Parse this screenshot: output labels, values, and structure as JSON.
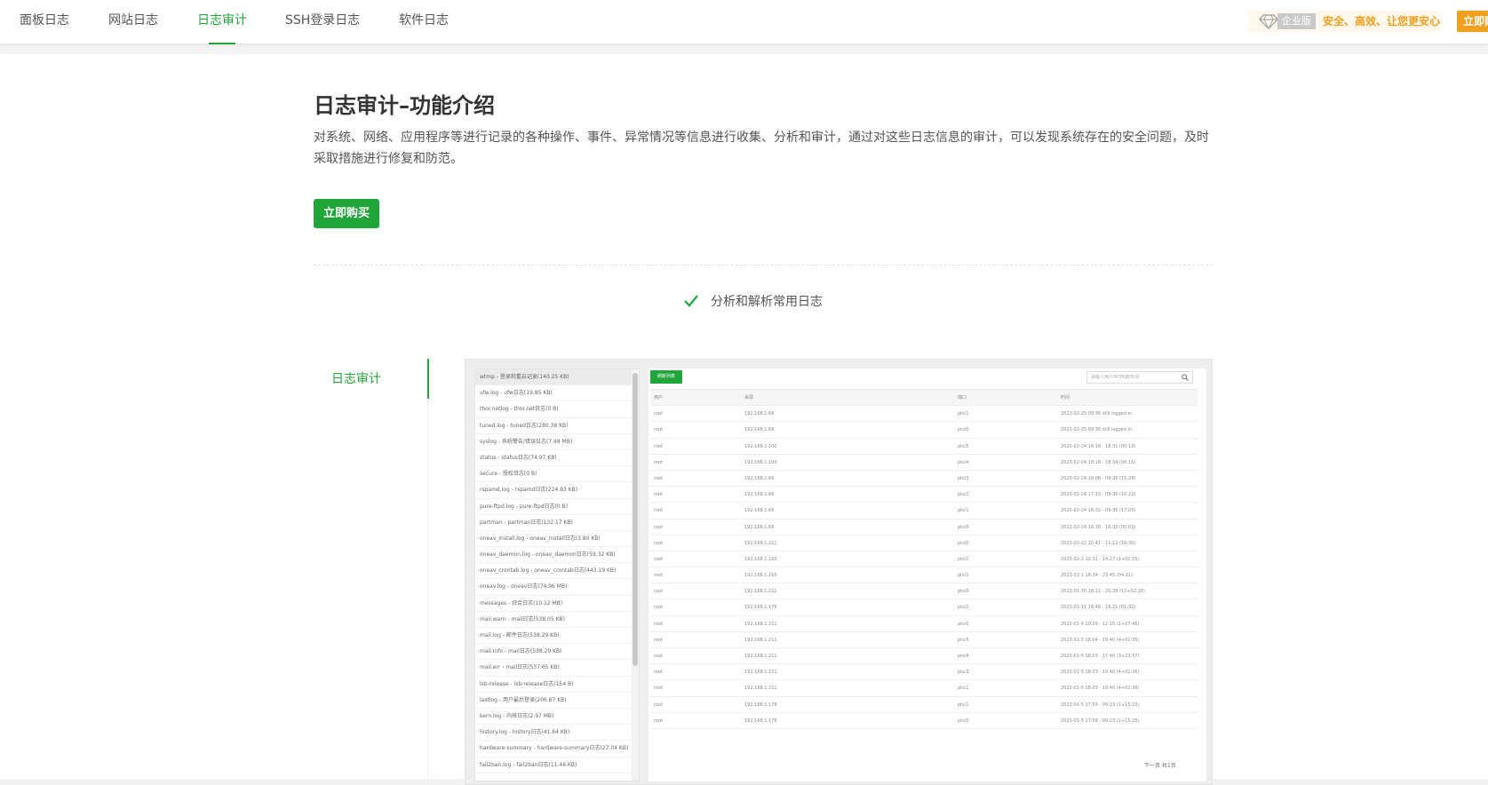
{
  "tabs": [
    "面板日志",
    "网站日志",
    "日志审计",
    "SSH登录日志",
    "软件日志"
  ],
  "active_tab": "日志审计",
  "promo": {
    "badge": "企业版",
    "text": "安全、高效、让您更安心",
    "buy": "立即购买"
  },
  "intro": {
    "title": "日志审计–功能介绍",
    "description": "对系统、网络、应用程序等进行记录的各种操作、事件、异常情况等信息进行收集、分析和审计，通过对这些日志信息的审计，可以发现系统存在的安全问题，及时采取措施进行修复和防范。",
    "buy_button": "立即购买",
    "feature": "分析和解析常用日志",
    "side_tab": "日志审计"
  },
  "preview": {
    "log_files": [
      "wtmp - 登录和重启记录(140.25 KB)",
      "ufw.log - ufw日志(19.85 KB)",
      "thor.netlog - thor.net日志(0 B)",
      "tuned.log - tuned日志(280.38 KB)",
      "syslog - 系统警告/错误日志(7.48 MB)",
      "status - status日志(74.97 KB)",
      "secure - 授权日志(0 B)",
      "rspamd.log - rspamd日志(224.83 KB)",
      "pure-ftpd.log - pure-ftpd日志(0 B)",
      "partman - partman日志(132.17 KB)",
      "oneav_install.log - oneav_install日志(3.80 KB)",
      "oneav_daemon.log - oneav_daemon日志(59.32 KB)",
      "oneav_crontab.log - oneav_crontab日志(443.19 KB)",
      "oneav.log - oneav日志(74.96 MB)",
      "messages - 综合日志(10.12 MB)",
      "mail.warn - mail日志(538.05 KB)",
      "mail.log - 邮件日志(538.29 KB)",
      "mail.info - mail日志(538.29 KB)",
      "mail.err - mail日志(537.65 KB)",
      "lsb-release - lsb-release日志(154 B)",
      "lastlog - 用户最后登录(206.87 KB)",
      "kern.log - 内核日志(2.97 MB)",
      "history.log - history日志(41.64 KB)",
      "hardware-summary - hardware-summary日志(27.04 KB)",
      "fail2ban.log - fail2ban日志(11.46 KB)"
    ],
    "refresh_label": "刷新列表",
    "search_placeholder": "请输入用户/IP/终端/时间",
    "columns": [
      "用户",
      "来源",
      "端口",
      "时间"
    ],
    "rows": [
      [
        "root",
        "192.168.1.66",
        "pts/1",
        "2023-02-25 09:36 still logged in"
      ],
      [
        "root",
        "192.168.1.66",
        "pts/0",
        "2023-02-25 09:36 still logged in"
      ],
      [
        "root",
        "192.168.1.100",
        "pts/5",
        "2023-02-24 18:18 - 18:31 (00:13)"
      ],
      [
        "root",
        "192.168.1.100",
        "pts/4",
        "2023-02-24 18:18 - 18:34 (00:15)"
      ],
      [
        "root",
        "192.168.1.66",
        "pts/3",
        "2023-02-24 18:08 - 09:36 (15:28)"
      ],
      [
        "root",
        "192.168.1.66",
        "pts/2",
        "2023-02-24 17:13 - 09:36 (16:22)"
      ],
      [
        "root",
        "192.168.1.66",
        "pts/1",
        "2023-02-24 16:32 - 09:36 (17:03)"
      ],
      [
        "root",
        "192.168.1.66",
        "pts/0",
        "2023-02-24 16:30 - 16:33 (00:02)"
      ],
      [
        "root",
        "192.168.1.211",
        "pts/0",
        "2023-02-22 15:41 - 11:12 (19:30)"
      ],
      [
        "root",
        "192.168.1.165",
        "pts/1",
        "2023-02-2 12:31 - 14:27 (1+01:55)"
      ],
      [
        "root",
        "192.168.1.165",
        "pts/1",
        "2023-02-1 18:34 - 23:45 (04:11)"
      ],
      [
        "root",
        "192.168.1.211",
        "pts/0",
        "2023-01-30 18:11 - 20:39 (12+02:28)"
      ],
      [
        "root",
        "192.168.1.178",
        "pts/2",
        "2023-01-11 16:49 - 18:21 (01:32)"
      ],
      [
        "root",
        "192.168.1.211",
        "pts/0",
        "2023-01-9 10:29 - 12:15 (2+17:45)"
      ],
      [
        "root",
        "192.168.1.211",
        "pts/5",
        "2023-01-5 18:04 - 19:40 (4+01:35)"
      ],
      [
        "root",
        "192.168.1.211",
        "pts/4",
        "2023-01-5 18:03 - 17:40 (3+23:37)"
      ],
      [
        "root",
        "192.168.1.211",
        "pts/3",
        "2023-01-5 18:03 - 19:40 (4+01:36)"
      ],
      [
        "root",
        "192.168.1.211",
        "pts/2",
        "2023-01-5 18:03 - 19:40 (4+01:36)"
      ],
      [
        "root",
        "192.168.1.178",
        "pts/1",
        "2023-01-5 17:59 - 09:23 (1+15:23)"
      ],
      [
        "root",
        "192.168.1.178",
        "pts/0",
        "2023-01-5 17:58 - 09:23 (1+15:25)"
      ]
    ],
    "pager": "下一页   共1页"
  },
  "colors": {
    "accent": "#20a53a",
    "promo": "#f0a020"
  }
}
